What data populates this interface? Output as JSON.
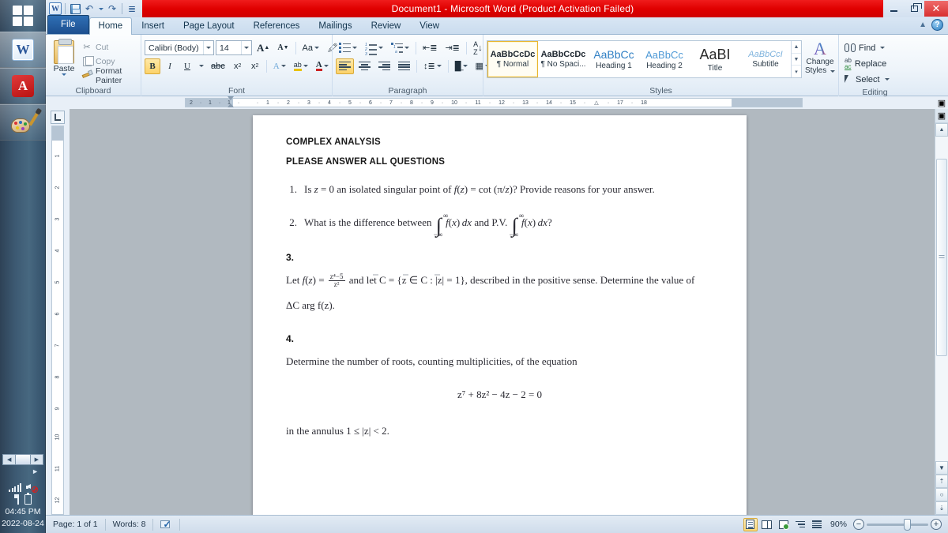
{
  "taskbar": {
    "start_label": "Start",
    "items": [
      {
        "name": "word",
        "label": "Microsoft Word",
        "glyph": "W"
      },
      {
        "name": "pdf",
        "label": "Adobe Reader",
        "glyph": "A"
      },
      {
        "name": "paint",
        "label": "Paint",
        "glyph": ""
      }
    ],
    "clock_time": "04:45 PM",
    "clock_date": "2022-08-24"
  },
  "titlebar": {
    "title": "Document1  -  Microsoft Word (Product Activation Failed)",
    "quick_access": [
      "word-icon",
      "save-icon",
      "undo-icon",
      "undo-dropdown",
      "redo-icon",
      "customize-qat"
    ]
  },
  "tabs": [
    {
      "label": "File",
      "active": false,
      "file": true
    },
    {
      "label": "Home",
      "active": true
    },
    {
      "label": "Insert",
      "active": false
    },
    {
      "label": "Page Layout",
      "active": false
    },
    {
      "label": "References",
      "active": false
    },
    {
      "label": "Mailings",
      "active": false
    },
    {
      "label": "Review",
      "active": false
    },
    {
      "label": "View",
      "active": false
    }
  ],
  "ribbon": {
    "clipboard": {
      "label": "Clipboard",
      "paste": "Paste",
      "cut": "Cut",
      "copy": "Copy",
      "format_painter": "Format Painter"
    },
    "font": {
      "label": "Font",
      "font_name": "Calibri (Body)",
      "font_size": "14",
      "grow": "A",
      "shrink": "A",
      "change_case": "Aa",
      "clear_formatting": "",
      "bold": "B",
      "italic": "I",
      "underline": "U",
      "strikethrough": "abc",
      "subscript": "x",
      "superscript": "x",
      "text_effects": "A",
      "highlight": "ab",
      "font_color": "A"
    },
    "paragraph": {
      "label": "Paragraph"
    },
    "styles": {
      "label": "Styles",
      "items": [
        {
          "preview": "AaBbCcDc",
          "name": "¶ Normal",
          "selected": true
        },
        {
          "preview": "AaBbCcDc",
          "name": "¶ No Spaci...",
          "selected": false
        },
        {
          "preview": "AaBbCс",
          "name": "Heading 1",
          "selected": false
        },
        {
          "preview": "AaBbCc",
          "name": "Heading 2",
          "selected": false
        },
        {
          "preview": "AaBІ",
          "name": "Title",
          "selected": false
        },
        {
          "preview": "AaBbCcI",
          "name": "Subtitle",
          "selected": false
        }
      ],
      "change_styles": "Change",
      "change_styles2": "Styles"
    },
    "editing": {
      "label": "Editing",
      "find": "Find",
      "replace": "Replace",
      "select": "Select"
    }
  },
  "ruler": {
    "left_marks": [
      "2",
      "1",
      "1"
    ],
    "marks": [
      "1",
      "1",
      "2",
      "3",
      "4",
      "5",
      "6",
      "7",
      "8",
      "9",
      "10",
      "11",
      "12",
      "13",
      "14",
      "15",
      "17",
      "18"
    ]
  },
  "document": {
    "header1": "COMPLEX ANALYSIS",
    "header2": "PLEASE ANSWER ALL QUESTIONS",
    "q1": {
      "num": "1.",
      "text_a": "Is ",
      "text_b": " = 0 an isolated singular point of ",
      "text_c": " = cot (",
      "text_d": ")? Provide reasons for your answer.",
      "full": "1. Is z = 0 an isolated singular point of f(z) = cot (π/z)? Provide reasons for your answer."
    },
    "q2": {
      "num": "2.",
      "lead": "What is the difference between",
      "mid": "and P.V.",
      "integrand": "f(x) dx",
      "upper": "∞",
      "lower": "−∞",
      "full": "2. What is the difference between ∫(-∞..∞) f(x) dx and P.V. ∫(-∞..∞) f(x) dx?"
    },
    "q3": {
      "num": "3.",
      "lead": "Let ",
      "fz": "f(z) = ",
      "frac_num": "z⁴−5",
      "frac_den": "z²",
      "mid": " and let C = {z ∈ C : |z| = 1}, described in the positive sense.  Determine the value of",
      "tail": "ΔC arg f(z).",
      "full": "3. Let f(z) = (z⁴−5)/z² and let C = {z ∈ C : |z| = 1}, described in the positive sense. Determine the value of ΔC arg f(z)."
    },
    "q4": {
      "num": "4.",
      "lead": "Determine the number of roots, counting multiplicities, of the equation",
      "equation": "z⁷ + 8z² − 4z − 2 = 0",
      "tail": "in the annulus 1 ≤ |z| < 2.",
      "full": "4. Determine the number of roots, counting multiplicities, of the equation z⁷ + 8z² − 4z − 2 = 0 in the annulus 1 ≤ |z| < 2."
    }
  },
  "statusbar": {
    "page": "Page: 1 of 1",
    "words": "Words: 8",
    "proofing": "proofing-errors-icon",
    "zoom_value": "90%",
    "zoom_out": "−",
    "zoom_in": "+",
    "views": [
      "print-layout",
      "full-screen-reading",
      "web-layout",
      "outline",
      "draft"
    ]
  },
  "colors": {
    "title_red": "#e00000",
    "ribbon_bg": "#eef4fa",
    "tab_blue": "#1c4f8f",
    "accent_yellow": "#fcd26a",
    "taskbar": "#3d5a73"
  }
}
